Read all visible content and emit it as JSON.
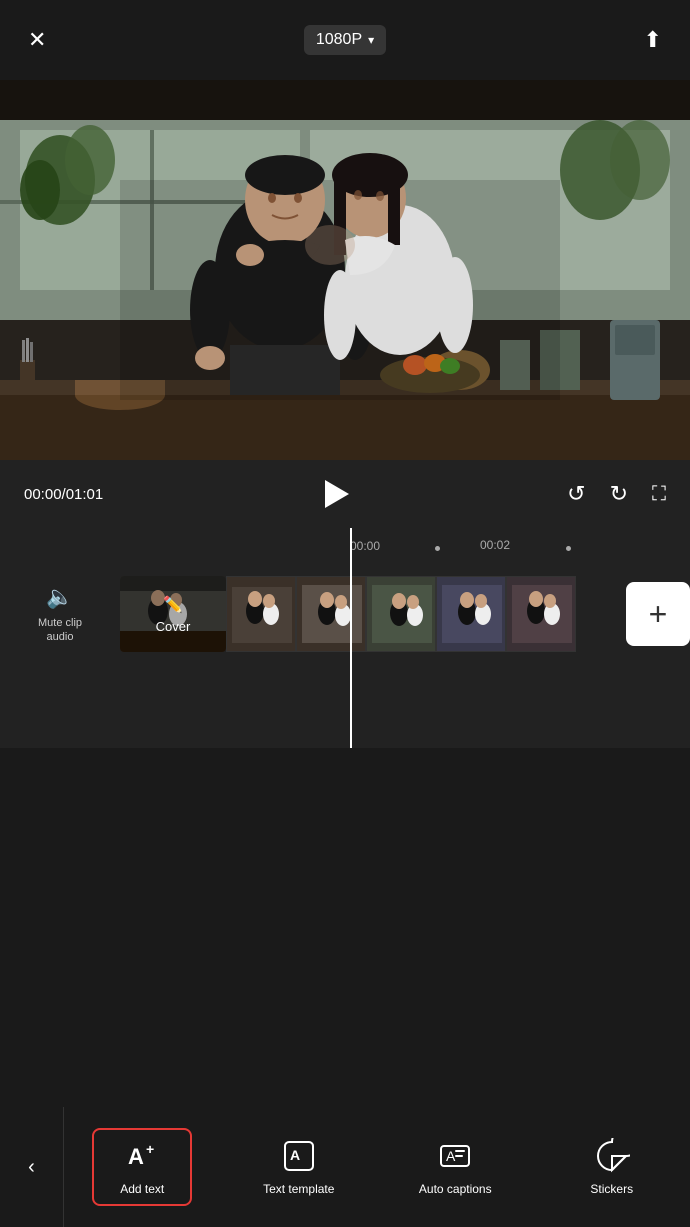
{
  "topbar": {
    "close_label": "✕",
    "resolution": "1080P",
    "chevron": "▾",
    "upload_label": "⬆"
  },
  "playback": {
    "current_time": "00:00",
    "total_time": "01:01",
    "separator": "/",
    "timecode": "00:00/01:01"
  },
  "timeline": {
    "marker_0": "00:00",
    "marker_2": "00:02",
    "cover_label": "Cover",
    "mute_line1": "Mute clip",
    "mute_line2": "audio"
  },
  "toolbar": {
    "back_label": "‹",
    "items": [
      {
        "id": "add-text",
        "icon": "A+",
        "label": "Add text",
        "active": true
      },
      {
        "id": "text-template",
        "icon": "template",
        "label": "Text template",
        "active": false
      },
      {
        "id": "auto-captions",
        "icon": "captions",
        "label": "Auto captions",
        "active": false
      },
      {
        "id": "stickers",
        "icon": "sticker",
        "label": "Stickers",
        "active": false
      }
    ]
  },
  "colors": {
    "active_border": "#e53935",
    "background": "#1a1a1a",
    "timeline_bg": "#222222",
    "text_primary": "#ffffff",
    "text_secondary": "#aaaaaa"
  }
}
